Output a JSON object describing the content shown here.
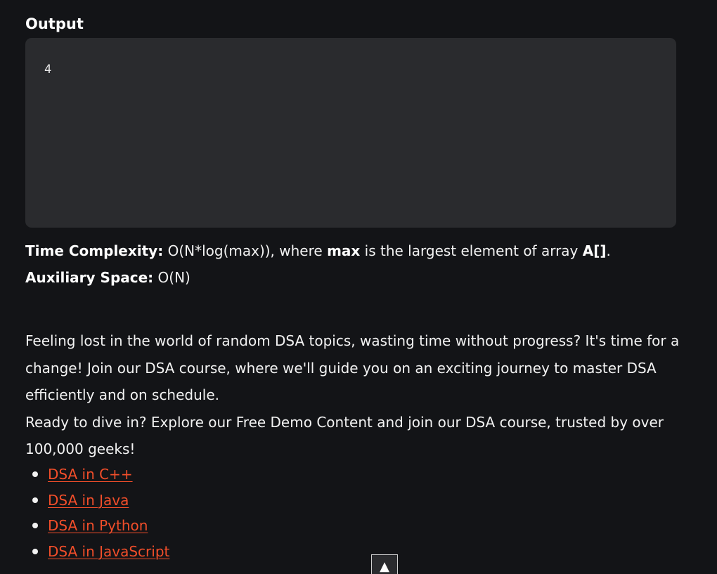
{
  "output": {
    "heading": "Output",
    "value": "4"
  },
  "complexity": {
    "time_label": "Time Complexity:",
    "time_text_1": " O(N*log(max)), where ",
    "time_bold_max": "max",
    "time_text_2": " is the largest element of array ",
    "time_bold_array": "A[]",
    "time_text_3": ".",
    "space_label": "Auxiliary Space:",
    "space_value": " O(N)"
  },
  "promo": {
    "paragraph_1": "Feeling lost in the world of random DSA topics, wasting time without progress? It's time for a change! Join our DSA course, where we'll guide you on an exciting journey to master DSA efficiently and on schedule.",
    "paragraph_2": "Ready to dive in? Explore our Free Demo Content and join our DSA course, trusted by over 100,000 geeks!"
  },
  "courses": [
    {
      "label": "DSA in C++"
    },
    {
      "label": "DSA in Java"
    },
    {
      "label": "DSA in Python"
    },
    {
      "label": "DSA in JavaScript"
    }
  ],
  "scroll_top": {
    "icon": "arrow-up-icon",
    "glyph": "▲"
  },
  "colors": {
    "background": "#131417",
    "code_box": "#2a2b2e",
    "link": "#f24e2a",
    "text": "#f2f2f2"
  }
}
